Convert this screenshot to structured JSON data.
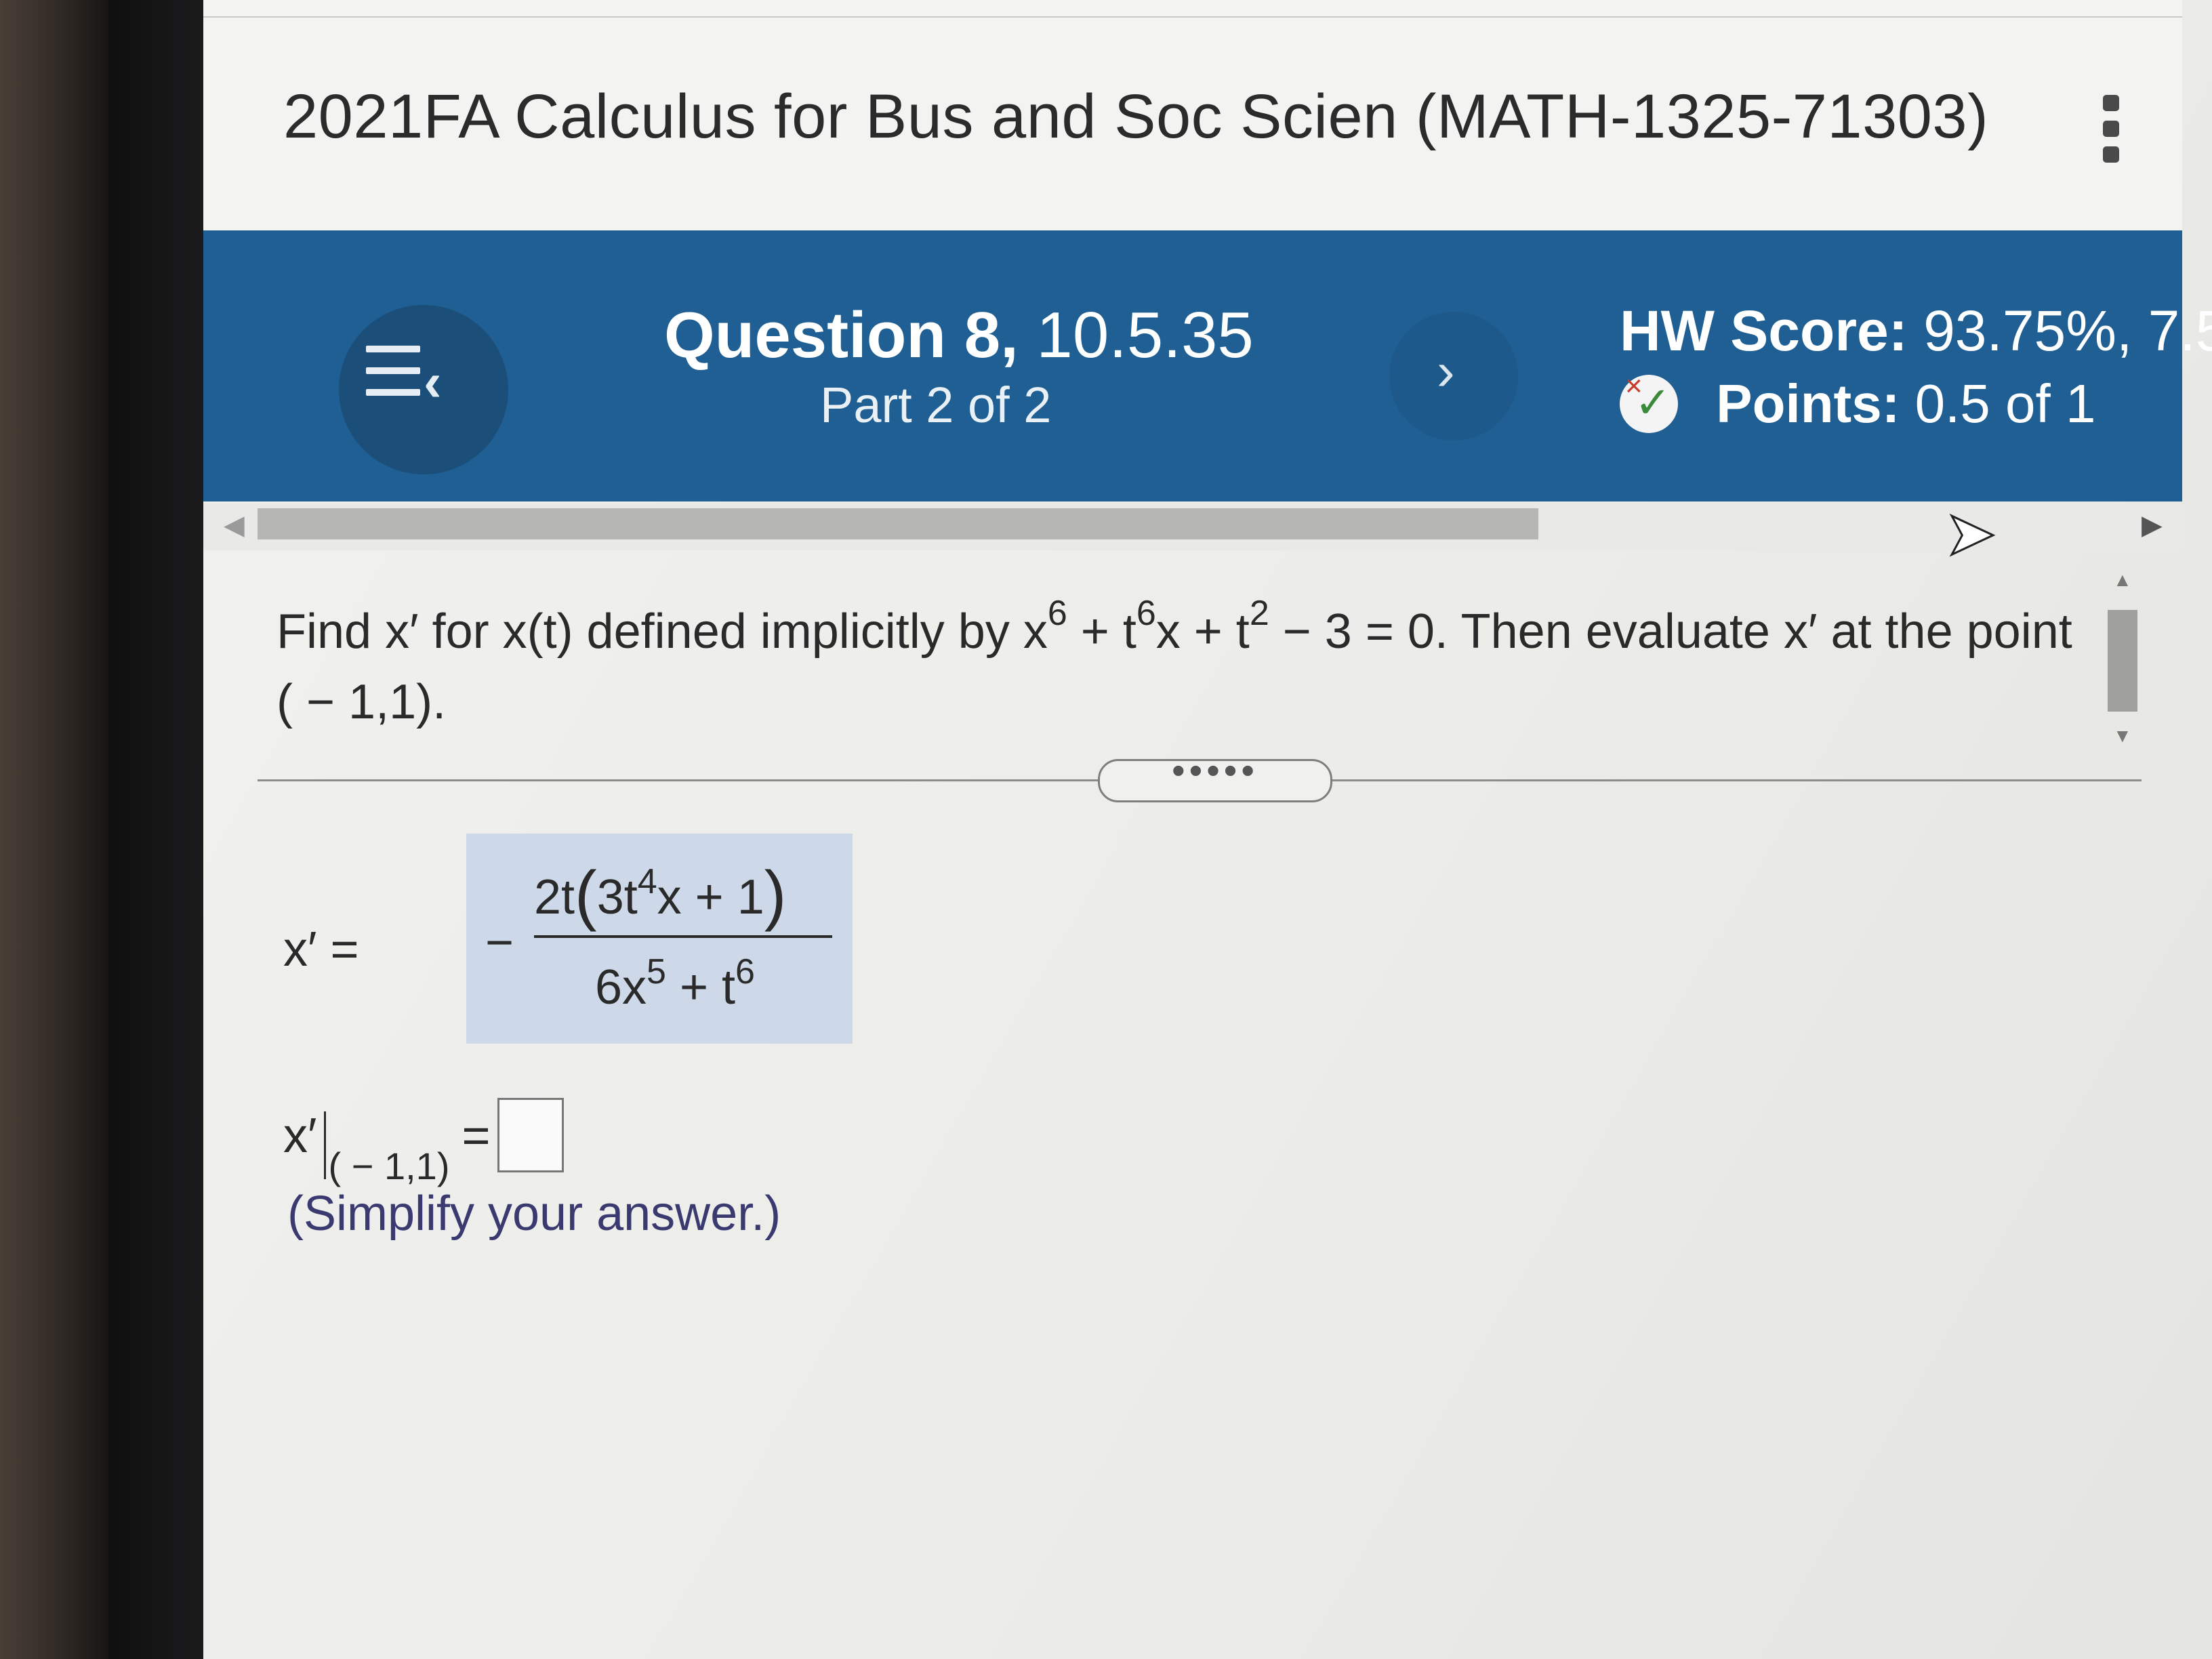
{
  "course": {
    "title": "2021FA Calculus for Bus and Soc Scien (MATH-1325-71303)",
    "menu_icon": "kebab-menu-icon"
  },
  "question_bar": {
    "question_label": "Question 8,",
    "question_id": "10.5.35",
    "part": "Part 2 of 2",
    "hw_score_label": "HW Score:",
    "hw_score_value": "93.75%, 7.5",
    "points_label": "Points:",
    "points_value": "0.5 of 1",
    "nav_prev_icon": "question-list-icon",
    "nav_next_icon": "chevron-right-icon",
    "accent_color": "#1f5f93"
  },
  "problem": {
    "text_a": "Find x′ for x(t) defined implicitly by x",
    "exp_a": "6",
    "text_b": " + t",
    "exp_b": "6",
    "text_c": "x + t",
    "exp_c": "2",
    "text_d": " − 3 = 0.  Then evaluate x′ at the point ( − 1,1)."
  },
  "answer_part1": {
    "label": "x′ =",
    "sign": "−",
    "numerator_a": "2t",
    "paren_open": "(",
    "numerator_b": "3t",
    "numerator_exp": "4",
    "numerator_c": "x + 1",
    "paren_close": ")",
    "denominator_a": "6x",
    "denominator_exp_a": "5",
    "denominator_b": " + t",
    "denominator_exp_b": "6"
  },
  "answer_part2": {
    "label": "x′",
    "subscript": "( − 1,1)",
    "equals": "=",
    "input_value": "",
    "hint": "(Simplify your answer.)"
  }
}
